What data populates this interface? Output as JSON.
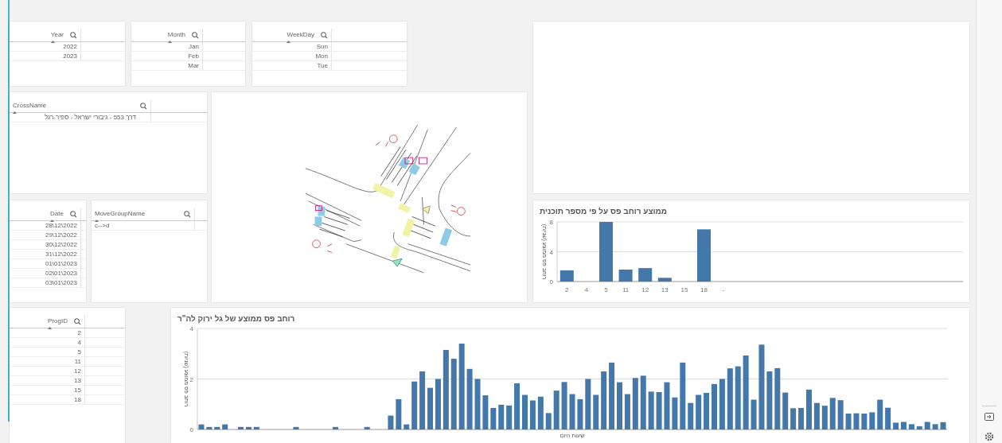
{
  "filters": [
    {
      "field": "Year",
      "values": [
        "2022",
        "2023"
      ]
    },
    {
      "field": "Month",
      "values": [
        "Jan",
        "Feb",
        "Mar"
      ]
    },
    {
      "field": "WeekDay",
      "values": [
        "Sun",
        "Mon",
        "Tue"
      ]
    },
    {
      "field": "CrossName",
      "values": [
        "דרך 553 - גיבורי ישראל - ספיר-רגל"
      ]
    },
    {
      "field": "Date",
      "values": [
        "28\\12\\2022",
        "29\\12\\2022",
        "30\\12\\2022",
        "31\\12\\2022",
        "01\\01\\2023",
        "02\\01\\2023",
        "03\\01\\2023"
      ]
    },
    {
      "field": "MoveGroupName",
      "values": [
        "c-->d"
      ]
    },
    {
      "field": "ProgID",
      "values": [
        "2",
        "4",
        "5",
        "11",
        "12",
        "13",
        "15",
        "18"
      ]
    }
  ],
  "program_chart": {
    "chart_data": {
      "type": "bar",
      "title": "ממוצע רוחב פס על פי מספר תוכנית",
      "ylabel": "רוחב פס ממוצע (שניות)",
      "categories": [
        "2",
        "4",
        "5",
        "11",
        "12",
        "13",
        "15",
        "18",
        "-"
      ],
      "values": [
        1.5,
        0,
        8,
        1.6,
        1.8,
        0.5,
        0,
        7,
        null
      ],
      "ylim": [
        0,
        8
      ],
      "yticks": [
        0,
        4,
        8
      ]
    }
  },
  "hourly_chart": {
    "chart_data": {
      "type": "bar",
      "title": "רוחב פס ממוצע של גל ירוק לה\"ר",
      "xlabel": "שעות היום",
      "ylabel": "רוחב פס ממוצע (שניות)",
      "ylim": [
        0,
        4
      ],
      "yticks": [
        0,
        2,
        4
      ],
      "values": [
        0.2,
        0.1,
        0.1,
        0.2,
        0,
        0.1,
        0.1,
        0.1,
        0,
        0,
        0,
        0,
        0.1,
        0,
        0,
        0,
        0,
        0.1,
        0,
        0,
        0,
        0.1,
        0,
        0,
        0.55,
        1.2,
        0.2,
        1.9,
        2.3,
        1.65,
        2.0,
        3.15,
        2.8,
        3.4,
        2.4,
        2.0,
        1.35,
        0.85,
        0.98,
        0.95,
        1.83,
        1.37,
        1.15,
        1.3,
        0.65,
        1.54,
        1.88,
        1.4,
        1.2,
        2.0,
        1.37,
        2.3,
        2.65,
        1.87,
        1.4,
        2.04,
        2.13,
        1.5,
        1.48,
        1.87,
        1.27,
        2.65,
        1.05,
        1.37,
        1.45,
        1.8,
        2.0,
        2.42,
        2.5,
        2.93,
        1.18,
        3.36,
        2.3,
        2.43,
        1.46,
        0.84,
        0.85,
        1.58,
        1.05,
        0.94,
        1.25,
        1.16,
        0.63,
        0.64,
        0.63,
        0.68,
        1.18,
        0.86,
        0.27,
        0.3,
        0.21,
        0.13,
        0.3,
        0.21,
        0.29
      ]
    }
  }
}
